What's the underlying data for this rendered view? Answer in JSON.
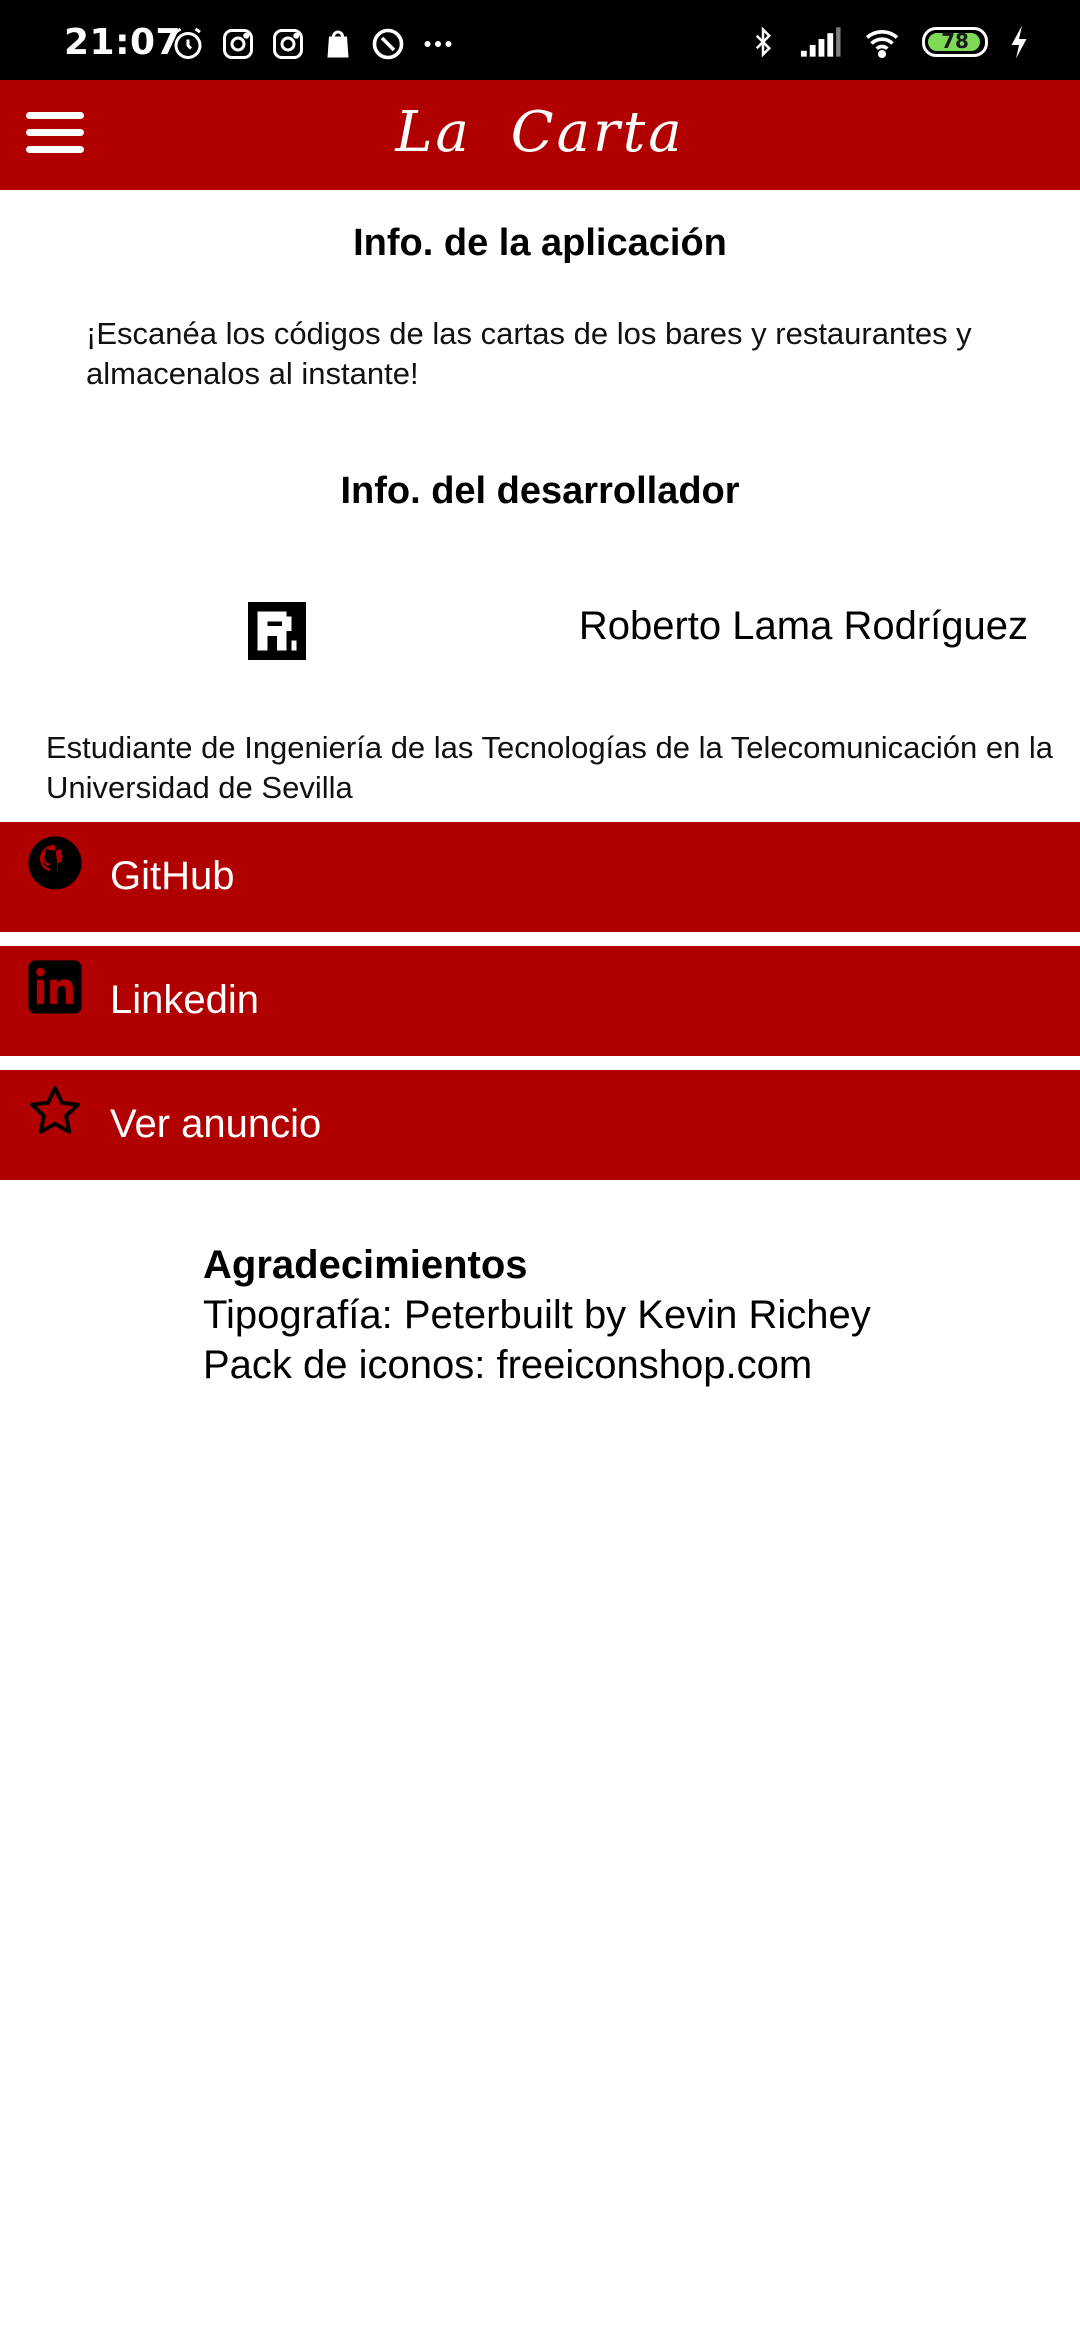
{
  "status_bar": {
    "time": "21:07",
    "battery": "78",
    "icons_left": [
      "alarm-icon",
      "instagram-icon",
      "instagram-icon",
      "shopping-bag-icon",
      "at-sign-icon",
      "more-dots-icon"
    ],
    "icons_right": [
      "bluetooth-icon",
      "signal-icon",
      "wifi-icon",
      "battery-icon",
      "charging-icon"
    ]
  },
  "app_bar": {
    "title": "La Carta",
    "menu_icon": "hamburger-menu-icon"
  },
  "app_info": {
    "heading": "Info. de la aplicación",
    "description": "¡Escanéa los códigos de las cartas de los bares y restaurantes y almacenalos al instante!"
  },
  "developer": {
    "heading": "Info. del desarrollador",
    "name": "Roberto Lama Rodríguez",
    "bio": "Estudiante de Ingeniería de las Tecnologías de la Telecomunicación en la Universidad de Sevilla"
  },
  "links": [
    {
      "label": "GitHub",
      "icon": "github-icon"
    },
    {
      "label": "Linkedin",
      "icon": "linkedin-icon"
    },
    {
      "label": "Ver anuncio",
      "icon": "star-icon"
    }
  ],
  "acknowledgements": {
    "title": "Agradecimientos",
    "font_credit": "Tipografía: Peterbuilt by Kevin Richey",
    "icons_credit": "Pack de iconos: freeiconshop.com"
  },
  "colors": {
    "primary": "#b00000",
    "status_bar": "#000000",
    "background": "#ffffff",
    "battery": "#7ed957"
  }
}
